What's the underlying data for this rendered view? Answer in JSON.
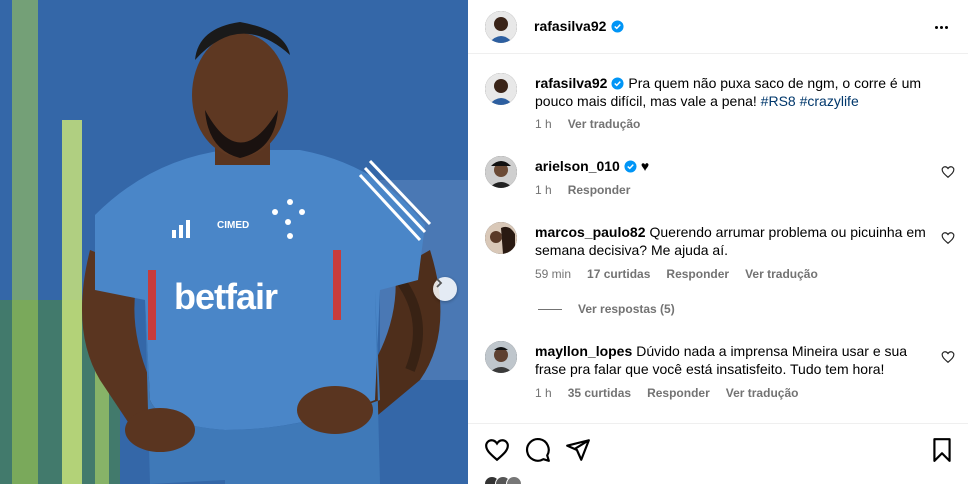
{
  "post": {
    "username": "rafasilva92",
    "caption_text": "Pra quem não puxa saco de ngm, o corre é um pouco mais difícil, mas vale a pena!",
    "hashtags": [
      "#RS8",
      "#crazylife"
    ],
    "time": "1 h",
    "see_translation": "Ver tradução"
  },
  "photo": {
    "jersey_sponsor": "betfair",
    "jersey_brand": "CIMED"
  },
  "comments": [
    {
      "username": "arielson_010",
      "text": "♥",
      "time": "1 h",
      "reply": "Responder"
    },
    {
      "username": "marcos_paulo82",
      "text": "Querendo arrumar problema ou picuinha em semana decisiva? Me ajuda aí.",
      "time": "59 min",
      "likes": "17 curtidas",
      "reply": "Responder",
      "translate": "Ver tradução",
      "view_replies": "Ver respostas (5)"
    },
    {
      "username": "mayllon_lopes",
      "text": "Dúvido nada a imprensa Mineira usar e sua frase pra falar que você está insatisfeito. Tudo tem hora!",
      "time": "1 h",
      "likes": "35 curtidas",
      "reply": "Responder",
      "translate": "Ver tradução"
    }
  ],
  "colors": {
    "verified_blue": "#0095f6",
    "hashtag": "#00376b",
    "meta_gray": "#737373"
  },
  "icons": [
    "more-icon",
    "heart-icon",
    "comment-icon",
    "share-icon",
    "bookmark-icon",
    "chevron-right-icon",
    "verified-icon"
  ]
}
